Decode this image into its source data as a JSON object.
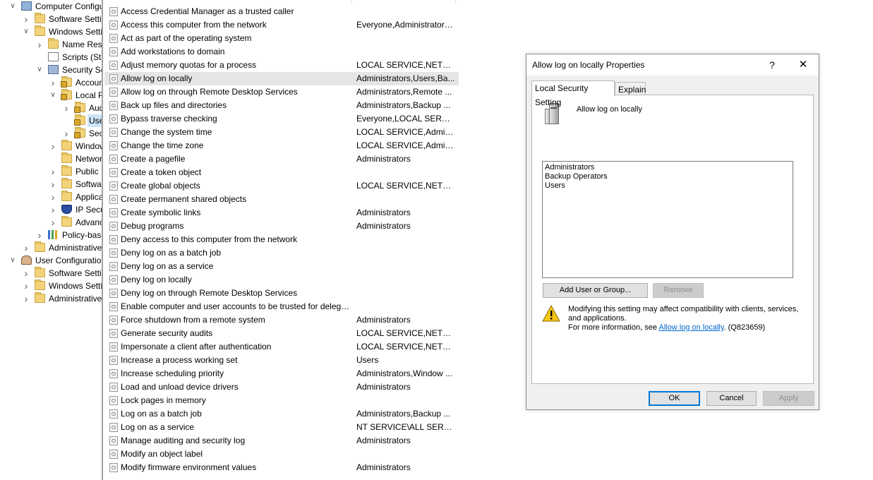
{
  "tree": {
    "items": [
      {
        "label": "Computer Configura",
        "icon": "computer-icon",
        "chevron": "open"
      },
      {
        "label": "Software Settings",
        "icon": "folder-icon",
        "chevron": "closed"
      },
      {
        "label": "Windows Settings",
        "icon": "folder-icon",
        "chevron": "open"
      },
      {
        "label": "Name Resolu",
        "icon": "folder-icon",
        "chevron": "closed"
      },
      {
        "label": "Scripts (Startu",
        "icon": "script-icon",
        "chevron": "none"
      },
      {
        "label": "Security Settin",
        "icon": "security-settings-icon",
        "chevron": "open"
      },
      {
        "label": "Account P",
        "icon": "locked-folder-icon",
        "chevron": "closed"
      },
      {
        "label": "Local Poli",
        "icon": "locked-folder-icon",
        "chevron": "open"
      },
      {
        "label": "Audit",
        "icon": "locked-folder-icon",
        "chevron": "closed"
      },
      {
        "label": "User R",
        "icon": "locked-folder-icon",
        "chevron": "none"
      },
      {
        "label": "Securi",
        "icon": "locked-folder-icon",
        "chevron": "closed"
      },
      {
        "label": "Windows",
        "icon": "folder-icon",
        "chevron": "closed"
      },
      {
        "label": "Network L",
        "icon": "folder-icon",
        "chevron": "none"
      },
      {
        "label": "Public Key",
        "icon": "folder-icon",
        "chevron": "closed"
      },
      {
        "label": "Software F",
        "icon": "folder-icon",
        "chevron": "closed"
      },
      {
        "label": "Applicatio",
        "icon": "folder-icon",
        "chevron": "closed"
      },
      {
        "label": "IP Security",
        "icon": "ip-security-icon",
        "chevron": "closed"
      },
      {
        "label": "Advanced",
        "icon": "folder-icon",
        "chevron": "closed"
      },
      {
        "label": "Policy-based",
        "icon": "qos-chart-icon",
        "chevron": "closed"
      },
      {
        "label": "Administrative Te",
        "icon": "folder-icon",
        "chevron": "closed"
      },
      {
        "label": "User Configuration",
        "icon": "user-icon",
        "chevron": "open"
      },
      {
        "label": "Software Settings",
        "icon": "folder-icon",
        "chevron": "closed"
      },
      {
        "label": "Windows Setting",
        "icon": "folder-icon",
        "chevron": "closed"
      },
      {
        "label": "Administrative Te",
        "icon": "folder-icon",
        "chevron": "closed"
      }
    ],
    "selected_index": 9
  },
  "policies": [
    {
      "name": "Access Credential Manager as a trusted caller",
      "value": ""
    },
    {
      "name": "Access this computer from the network",
      "value": "Everyone,Administrators..."
    },
    {
      "name": "Act as part of the operating system",
      "value": ""
    },
    {
      "name": "Add workstations to domain",
      "value": ""
    },
    {
      "name": "Adjust memory quotas for a process",
      "value": "LOCAL SERVICE,NETWO..."
    },
    {
      "name": "Allow log on locally",
      "value": "Administrators,Users,Ba..."
    },
    {
      "name": "Allow log on through Remote Desktop Services",
      "value": "Administrators,Remote ..."
    },
    {
      "name": "Back up files and directories",
      "value": "Administrators,Backup ..."
    },
    {
      "name": "Bypass traverse checking",
      "value": "Everyone,LOCAL SERVIC..."
    },
    {
      "name": "Change the system time",
      "value": "LOCAL SERVICE,Admini..."
    },
    {
      "name": "Change the time zone",
      "value": "LOCAL SERVICE,Admini..."
    },
    {
      "name": "Create a pagefile",
      "value": "Administrators"
    },
    {
      "name": "Create a token object",
      "value": ""
    },
    {
      "name": "Create global objects",
      "value": "LOCAL SERVICE,NETWO..."
    },
    {
      "name": "Create permanent shared objects",
      "value": ""
    },
    {
      "name": "Create symbolic links",
      "value": "Administrators"
    },
    {
      "name": "Debug programs",
      "value": "Administrators"
    },
    {
      "name": "Deny access to this computer from the network",
      "value": ""
    },
    {
      "name": "Deny log on as a batch job",
      "value": ""
    },
    {
      "name": "Deny log on as a service",
      "value": ""
    },
    {
      "name": "Deny log on locally",
      "value": ""
    },
    {
      "name": "Deny log on through Remote Desktop Services",
      "value": ""
    },
    {
      "name": "Enable computer and user accounts to be trusted for delega...",
      "value": ""
    },
    {
      "name": "Force shutdown from a remote system",
      "value": "Administrators"
    },
    {
      "name": "Generate security audits",
      "value": "LOCAL SERVICE,NETWO..."
    },
    {
      "name": "Impersonate a client after authentication",
      "value": "LOCAL SERVICE,NETWO..."
    },
    {
      "name": "Increase a process working set",
      "value": "Users"
    },
    {
      "name": "Increase scheduling priority",
      "value": "Administrators,Window ..."
    },
    {
      "name": "Load and unload device drivers",
      "value": "Administrators"
    },
    {
      "name": "Lock pages in memory",
      "value": ""
    },
    {
      "name": "Log on as a batch job",
      "value": "Administrators,Backup ..."
    },
    {
      "name": "Log on as a service",
      "value": "NT SERVICE\\ALL SERVICES"
    },
    {
      "name": "Manage auditing and security log",
      "value": "Administrators"
    },
    {
      "name": "Modify an object label",
      "value": ""
    },
    {
      "name": "Modify firmware environment values",
      "value": "Administrators"
    }
  ],
  "selected_policy_index": 5,
  "dialog": {
    "title": "Allow log on locally Properties",
    "help_glyph": "?",
    "close_glyph": "✕",
    "tabs": [
      {
        "label": "Local Security Setting",
        "active": true
      },
      {
        "label": "Explain",
        "active": false
      }
    ],
    "policy_name": "Allow log on locally",
    "members": [
      "Administrators",
      "Backup Operators",
      "Users"
    ],
    "add_button": "Add User or Group...",
    "remove_button": "Remove",
    "warning_line1": "Modifying this setting may affect compatibility with clients, services, and applications.",
    "warning_line2_prefix": "For more information, see ",
    "warning_link": "Allow log on locally",
    "warning_line2_suffix": ". (Q823659)",
    "ok_button": "OK",
    "cancel_button": "Cancel",
    "apply_button": "Apply"
  },
  "colors": {
    "selection_tree": "#cce4f7",
    "selection_list": "#e5e5e5",
    "link": "#0066cc",
    "default_button_border": "#0078d7"
  }
}
